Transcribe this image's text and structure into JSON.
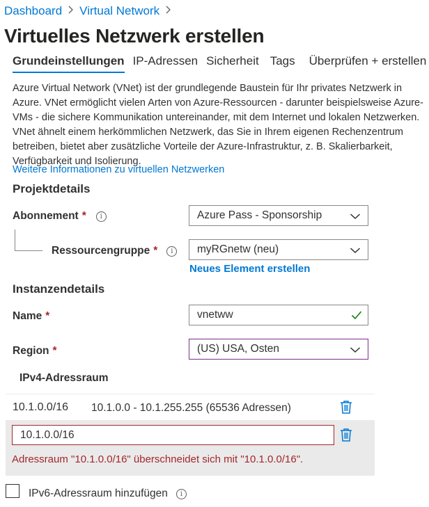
{
  "breadcrumb": {
    "items": [
      "Dashboard",
      "Virtual Network"
    ]
  },
  "page": {
    "title": "Virtuelles Netzwerk erstellen"
  },
  "tabs": [
    "Grundeinstellungen",
    "IP-Adressen",
    "Sicherheit",
    "Tags",
    "Überprüfen + erstellen"
  ],
  "description": {
    "text": "Azure Virtual Network (VNet) ist der grundlegende Baustein für Ihr privates Netzwerk in Azure. VNet ermöglicht vielen Arten von Azure-Ressourcen - darunter beispielsweise Azure-VMs - die sichere Kommunikation untereinander, mit dem Internet und lokalen Netzwerken. VNet ähnelt einem herkömmlichen Netzwerk, das Sie in Ihrem eigenen Rechenzentrum betreiben, bietet aber zusätzliche Vorteile der Azure-Infrastruktur, z. B. Skalierbarkeit, Verfügbarkeit und Isolierung.",
    "link": "Weitere Informationen zu virtuellen Netzwerken"
  },
  "project": {
    "heading": "Projektdetails",
    "subscription_label": "Abonnement",
    "subscription_value": "Azure Pass - Sponsorship",
    "rg_label": "Ressourcengruppe",
    "rg_value": "myRGnetw (neu)",
    "new_item_link": "Neues Element erstellen"
  },
  "instance": {
    "heading": "Instanzendetails",
    "name_label": "Name",
    "name_value": "vnetww",
    "region_label": "Region",
    "region_value": "(US) USA, Osten"
  },
  "ipv4": {
    "heading": "IPv4-Adressraum",
    "existing": {
      "cidr": "10.1.0.0/16",
      "range": "10.1.0.0 - 10.1.255.255 (65536 Adressen)"
    },
    "new_value": "10.1.0.0/16",
    "error": "Adressraum \"10.1.0.0/16\" überschneidet sich mit \"10.1.0.0/16\"."
  },
  "ipv6": {
    "label": "IPv6-Adressraum hinzufügen"
  },
  "common": {
    "required_mark": "*",
    "info_glyph": "i"
  },
  "colors": {
    "accent": "#0078d4",
    "error": "#a4262c",
    "focus": "#7a2e8a",
    "success": "#107c10"
  }
}
